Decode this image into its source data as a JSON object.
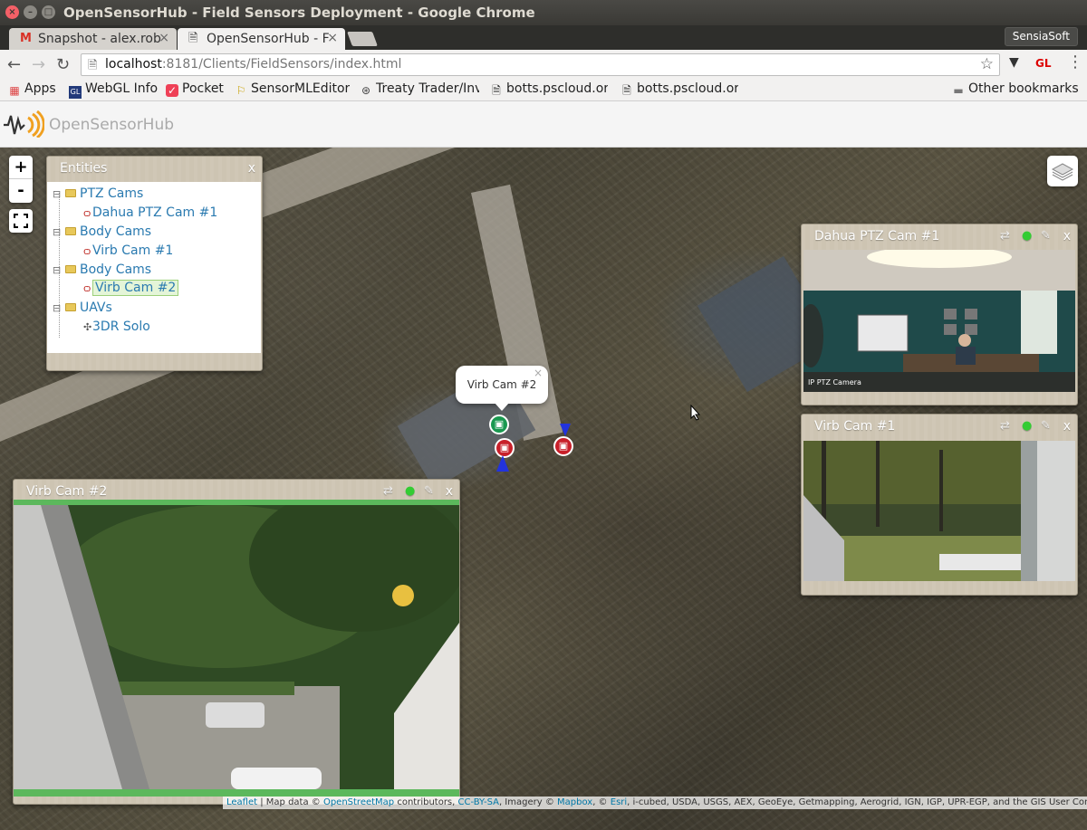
{
  "window": {
    "title": "OpenSensorHub - Field Sensors Deployment - Google Chrome"
  },
  "tabs": [
    {
      "label": "Snapshot - alex.rob",
      "icon": "gmail-icon"
    },
    {
      "label": "OpenSensorHub - F",
      "icon": "page-icon"
    }
  ],
  "profile": "SensiaSoft",
  "omnibox": {
    "host": "localhost",
    "port": ":8181",
    "path": "/Clients/FieldSensors/index.html"
  },
  "extensions": {
    "gl_label": "GL"
  },
  "bookmarks": [
    {
      "label": "Apps",
      "icon": "apps-grid-icon"
    },
    {
      "label": "WebGL Info",
      "icon": "webgl-icon"
    },
    {
      "label": "Pocket",
      "icon": "pocket-icon"
    },
    {
      "label": "SensorMLEditor",
      "icon": "sensorml-icon"
    },
    {
      "label": "Treaty Trader/Inv",
      "icon": "treaty-icon"
    },
    {
      "label": "botts.pscloud.or",
      "icon": "page-icon"
    },
    {
      "label": "botts.pscloud.or",
      "icon": "page-icon"
    }
  ],
  "other_bookmarks": "Other bookmarks",
  "app": {
    "name": "OpenSensorHub"
  },
  "map": {
    "zoom_in": "+",
    "zoom_out": "-",
    "popup_label": "Virb Cam #2",
    "attribution": {
      "leaflet": "Leaflet",
      "t1": " | Map data © ",
      "osm": "OpenStreetMap",
      "t2": " contributors, ",
      "ccbysa": "CC-BY-SA",
      "t3": ", Imagery © ",
      "mapbox": "Mapbox",
      "t4": ", © ",
      "esri": "Esri",
      "t5": ", i-cubed, USDA, USGS, AEX, GeoEye, Getmapping, Aerogrid, IGN, IGP, UPR-EGP, and the GIS User Community"
    }
  },
  "entities": {
    "title": "Entities",
    "close": "x",
    "groups": [
      {
        "label": "PTZ Cams",
        "child": "Dahua PTZ Cam #1"
      },
      {
        "label": "Body Cams",
        "child": "Virb Cam #1"
      },
      {
        "label": "Body Cams",
        "child": "Virb Cam #2"
      },
      {
        "label": "UAVs",
        "child": "3DR Solo"
      }
    ]
  },
  "video_panels": [
    {
      "title": "Dahua PTZ Cam #1",
      "overlay_text": "IP PTZ Camera",
      "close": "x"
    },
    {
      "title": "Virb Cam #1",
      "close": "x"
    },
    {
      "title": "Virb Cam #2",
      "close": "x"
    }
  ]
}
